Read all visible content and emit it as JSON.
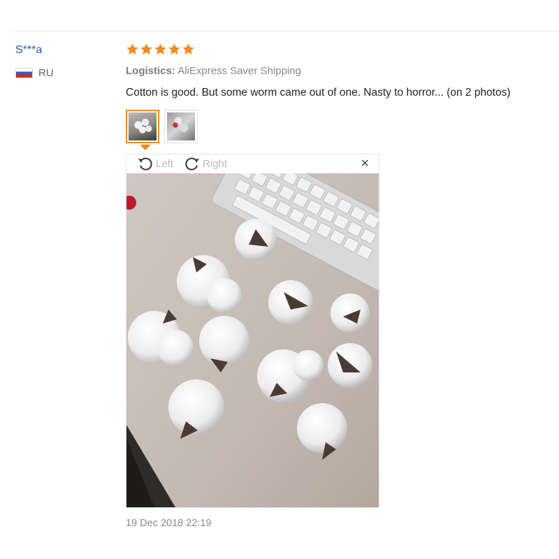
{
  "reviewer": {
    "name": "S***a",
    "country": "RU",
    "flag_icon": "russia-flag-icon"
  },
  "review": {
    "rating": 5,
    "rating_max": 5,
    "star_color": "#f08a24",
    "logistics_label": "Logistics:",
    "logistics_value": "AliExpress Saver Shipping",
    "text": "Cotton is good. But some worm came out of one. Nasty to horror... (on 2 photos)",
    "timestamp": "19 Dec 2018 22:19"
  },
  "photos": {
    "thumbnails": [
      "photo-1",
      "photo-2"
    ],
    "selected": 1
  },
  "viewer": {
    "rotate_left_label": "Left",
    "rotate_right_label": "Right",
    "close_symbol": "×"
  },
  "colors": {
    "accent": "#f08a24",
    "link": "#1f5fa8"
  }
}
